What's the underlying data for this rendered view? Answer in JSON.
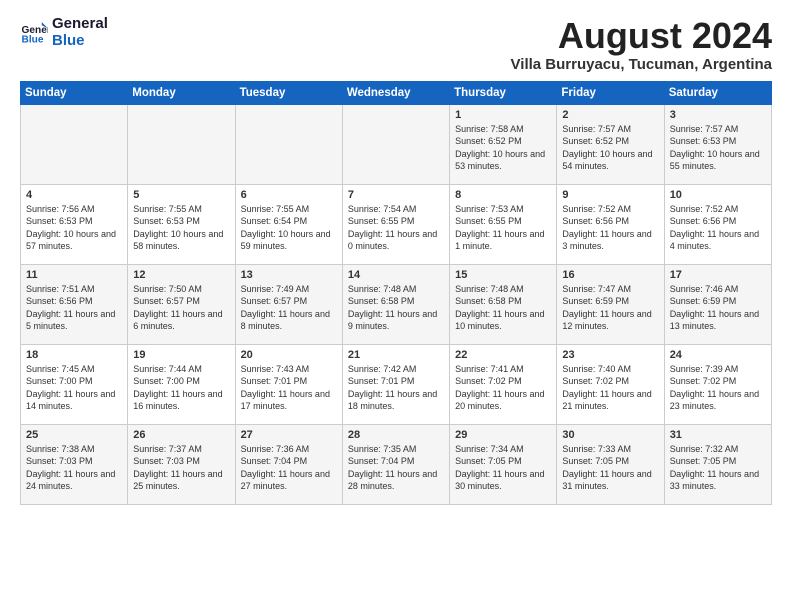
{
  "logo": {
    "line1": "General",
    "line2": "Blue"
  },
  "title": "August 2024",
  "subtitle": "Villa Burruyacu, Tucuman, Argentina",
  "weekdays": [
    "Sunday",
    "Monday",
    "Tuesday",
    "Wednesday",
    "Thursday",
    "Friday",
    "Saturday"
  ],
  "weeks": [
    [
      {
        "day": "",
        "sunrise": "",
        "sunset": "",
        "daylight": ""
      },
      {
        "day": "",
        "sunrise": "",
        "sunset": "",
        "daylight": ""
      },
      {
        "day": "",
        "sunrise": "",
        "sunset": "",
        "daylight": ""
      },
      {
        "day": "",
        "sunrise": "",
        "sunset": "",
        "daylight": ""
      },
      {
        "day": "1",
        "sunrise": "Sunrise: 7:58 AM",
        "sunset": "Sunset: 6:52 PM",
        "daylight": "Daylight: 10 hours and 53 minutes."
      },
      {
        "day": "2",
        "sunrise": "Sunrise: 7:57 AM",
        "sunset": "Sunset: 6:52 PM",
        "daylight": "Daylight: 10 hours and 54 minutes."
      },
      {
        "day": "3",
        "sunrise": "Sunrise: 7:57 AM",
        "sunset": "Sunset: 6:53 PM",
        "daylight": "Daylight: 10 hours and 55 minutes."
      }
    ],
    [
      {
        "day": "4",
        "sunrise": "Sunrise: 7:56 AM",
        "sunset": "Sunset: 6:53 PM",
        "daylight": "Daylight: 10 hours and 57 minutes."
      },
      {
        "day": "5",
        "sunrise": "Sunrise: 7:55 AM",
        "sunset": "Sunset: 6:53 PM",
        "daylight": "Daylight: 10 hours and 58 minutes."
      },
      {
        "day": "6",
        "sunrise": "Sunrise: 7:55 AM",
        "sunset": "Sunset: 6:54 PM",
        "daylight": "Daylight: 10 hours and 59 minutes."
      },
      {
        "day": "7",
        "sunrise": "Sunrise: 7:54 AM",
        "sunset": "Sunset: 6:55 PM",
        "daylight": "Daylight: 11 hours and 0 minutes."
      },
      {
        "day": "8",
        "sunrise": "Sunrise: 7:53 AM",
        "sunset": "Sunset: 6:55 PM",
        "daylight": "Daylight: 11 hours and 1 minute."
      },
      {
        "day": "9",
        "sunrise": "Sunrise: 7:52 AM",
        "sunset": "Sunset: 6:56 PM",
        "daylight": "Daylight: 11 hours and 3 minutes."
      },
      {
        "day": "10",
        "sunrise": "Sunrise: 7:52 AM",
        "sunset": "Sunset: 6:56 PM",
        "daylight": "Daylight: 11 hours and 4 minutes."
      }
    ],
    [
      {
        "day": "11",
        "sunrise": "Sunrise: 7:51 AM",
        "sunset": "Sunset: 6:56 PM",
        "daylight": "Daylight: 11 hours and 5 minutes."
      },
      {
        "day": "12",
        "sunrise": "Sunrise: 7:50 AM",
        "sunset": "Sunset: 6:57 PM",
        "daylight": "Daylight: 11 hours and 6 minutes."
      },
      {
        "day": "13",
        "sunrise": "Sunrise: 7:49 AM",
        "sunset": "Sunset: 6:57 PM",
        "daylight": "Daylight: 11 hours and 8 minutes."
      },
      {
        "day": "14",
        "sunrise": "Sunrise: 7:48 AM",
        "sunset": "Sunset: 6:58 PM",
        "daylight": "Daylight: 11 hours and 9 minutes."
      },
      {
        "day": "15",
        "sunrise": "Sunrise: 7:48 AM",
        "sunset": "Sunset: 6:58 PM",
        "daylight": "Daylight: 11 hours and 10 minutes."
      },
      {
        "day": "16",
        "sunrise": "Sunrise: 7:47 AM",
        "sunset": "Sunset: 6:59 PM",
        "daylight": "Daylight: 11 hours and 12 minutes."
      },
      {
        "day": "17",
        "sunrise": "Sunrise: 7:46 AM",
        "sunset": "Sunset: 6:59 PM",
        "daylight": "Daylight: 11 hours and 13 minutes."
      }
    ],
    [
      {
        "day": "18",
        "sunrise": "Sunrise: 7:45 AM",
        "sunset": "Sunset: 7:00 PM",
        "daylight": "Daylight: 11 hours and 14 minutes."
      },
      {
        "day": "19",
        "sunrise": "Sunrise: 7:44 AM",
        "sunset": "Sunset: 7:00 PM",
        "daylight": "Daylight: 11 hours and 16 minutes."
      },
      {
        "day": "20",
        "sunrise": "Sunrise: 7:43 AM",
        "sunset": "Sunset: 7:01 PM",
        "daylight": "Daylight: 11 hours and 17 minutes."
      },
      {
        "day": "21",
        "sunrise": "Sunrise: 7:42 AM",
        "sunset": "Sunset: 7:01 PM",
        "daylight": "Daylight: 11 hours and 18 minutes."
      },
      {
        "day": "22",
        "sunrise": "Sunrise: 7:41 AM",
        "sunset": "Sunset: 7:02 PM",
        "daylight": "Daylight: 11 hours and 20 minutes."
      },
      {
        "day": "23",
        "sunrise": "Sunrise: 7:40 AM",
        "sunset": "Sunset: 7:02 PM",
        "daylight": "Daylight: 11 hours and 21 minutes."
      },
      {
        "day": "24",
        "sunrise": "Sunrise: 7:39 AM",
        "sunset": "Sunset: 7:02 PM",
        "daylight": "Daylight: 11 hours and 23 minutes."
      }
    ],
    [
      {
        "day": "25",
        "sunrise": "Sunrise: 7:38 AM",
        "sunset": "Sunset: 7:03 PM",
        "daylight": "Daylight: 11 hours and 24 minutes."
      },
      {
        "day": "26",
        "sunrise": "Sunrise: 7:37 AM",
        "sunset": "Sunset: 7:03 PM",
        "daylight": "Daylight: 11 hours and 25 minutes."
      },
      {
        "day": "27",
        "sunrise": "Sunrise: 7:36 AM",
        "sunset": "Sunset: 7:04 PM",
        "daylight": "Daylight: 11 hours and 27 minutes."
      },
      {
        "day": "28",
        "sunrise": "Sunrise: 7:35 AM",
        "sunset": "Sunset: 7:04 PM",
        "daylight": "Daylight: 11 hours and 28 minutes."
      },
      {
        "day": "29",
        "sunrise": "Sunrise: 7:34 AM",
        "sunset": "Sunset: 7:05 PM",
        "daylight": "Daylight: 11 hours and 30 minutes."
      },
      {
        "day": "30",
        "sunrise": "Sunrise: 7:33 AM",
        "sunset": "Sunset: 7:05 PM",
        "daylight": "Daylight: 11 hours and 31 minutes."
      },
      {
        "day": "31",
        "sunrise": "Sunrise: 7:32 AM",
        "sunset": "Sunset: 7:05 PM",
        "daylight": "Daylight: 11 hours and 33 minutes."
      }
    ]
  ]
}
